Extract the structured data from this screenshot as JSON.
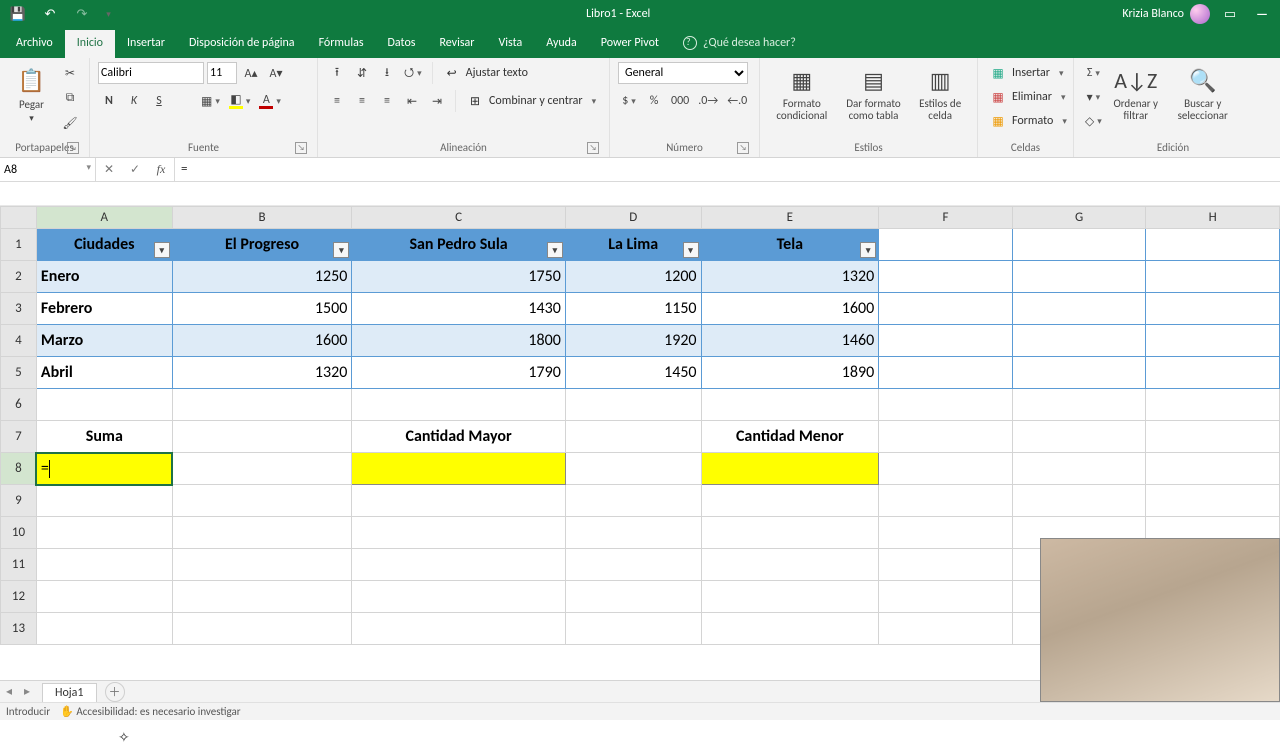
{
  "title": "Libro1 - Excel",
  "user_name": "Krizia Blanco",
  "tabs": [
    "Archivo",
    "Inicio",
    "Insertar",
    "Disposición de página",
    "Fórmulas",
    "Datos",
    "Revisar",
    "Vista",
    "Ayuda",
    "Power Pivot"
  ],
  "active_tab": 1,
  "tell_me": "¿Qué desea hacer?",
  "ribbon": {
    "clipboard": {
      "paste": "Pegar",
      "label": "Portapapeles"
    },
    "font": {
      "label": "Fuente",
      "name": "Calibri",
      "size": "11"
    },
    "align": {
      "label": "Alineación",
      "wrap": "Ajustar texto",
      "merge": "Combinar y centrar"
    },
    "number": {
      "label": "Número",
      "format": "General"
    },
    "styles": {
      "label": "Estilos",
      "cond": "Formato condicional",
      "table": "Dar formato como tabla",
      "cell": "Estilos de celda"
    },
    "cells": {
      "label": "Celdas",
      "insert": "Insertar",
      "delete": "Eliminar",
      "format": "Formato"
    },
    "editing": {
      "label": "Edición",
      "sort": "Ordenar y filtrar",
      "find": "Buscar y seleccionar"
    }
  },
  "namebox": "A8",
  "formula": "=",
  "columns": [
    "A",
    "B",
    "C",
    "D",
    "E",
    "F",
    "G",
    "H"
  ],
  "headers": [
    "Ciudades",
    "El Progreso",
    "San Pedro Sula",
    "La Lima",
    "Tela"
  ],
  "rows": [
    {
      "m": "Enero",
      "v": [
        "1250",
        "1750",
        "1200",
        "1320"
      ]
    },
    {
      "m": "Febrero",
      "v": [
        "1500",
        "1430",
        "1150",
        "1600"
      ]
    },
    {
      "m": "Marzo",
      "v": [
        "1600",
        "1800",
        "1920",
        "1460"
      ]
    },
    {
      "m": "Abril",
      "v": [
        "1320",
        "1790",
        "1450",
        "1890"
      ]
    }
  ],
  "labels": {
    "suma": "Suma",
    "mayor": "Cantidad Mayor",
    "menor": "Cantidad Menor"
  },
  "active_cell_value": "=",
  "sheet_tab": "Hoja1",
  "status_mode": "Introducir",
  "status_acc": "Accesibilidad: es necesario investigar"
}
